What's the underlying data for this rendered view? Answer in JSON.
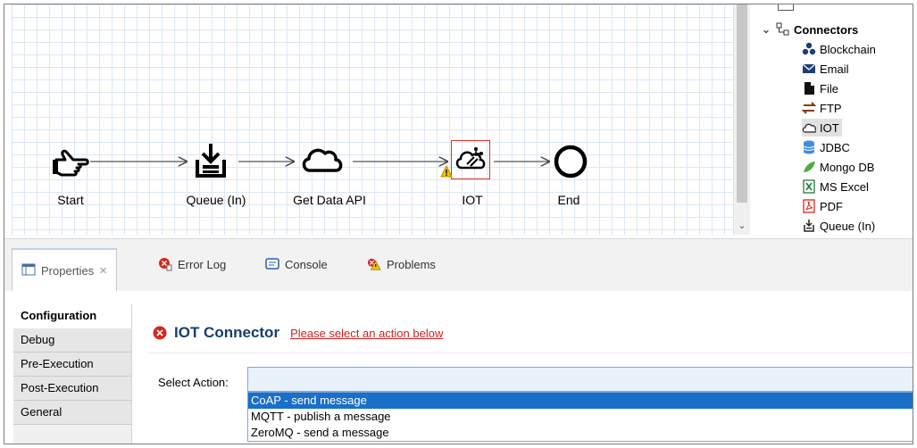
{
  "canvas": {
    "nodes": [
      {
        "label": "Start",
        "icon": "hand-point-icon"
      },
      {
        "label": "Queue (In)",
        "icon": "inbox-download-icon"
      },
      {
        "label": "Get Data API",
        "icon": "cloud-icon"
      },
      {
        "label": "IOT",
        "icon": "iot-cloud-icon"
      },
      {
        "label": "End",
        "icon": "end-circle-icon"
      }
    ]
  },
  "palette": {
    "group_label": "Connectors",
    "items": [
      {
        "label": "Blockchain",
        "icon": "blockchain-icon"
      },
      {
        "label": "Email",
        "icon": "email-icon"
      },
      {
        "label": "File",
        "icon": "file-icon"
      },
      {
        "label": "FTP",
        "icon": "ftp-arrows-icon"
      },
      {
        "label": "IOT",
        "icon": "iot-cloud-icon"
      },
      {
        "label": "JDBC",
        "icon": "database-icon"
      },
      {
        "label": "Mongo DB",
        "icon": "mongodb-leaf-icon"
      },
      {
        "label": "MS Excel",
        "icon": "excel-icon"
      },
      {
        "label": "PDF",
        "icon": "pdf-icon"
      },
      {
        "label": "Queue (In)",
        "icon": "inbox-download-icon"
      }
    ]
  },
  "tabs": [
    {
      "label": "Properties",
      "icon": "properties-icon"
    },
    {
      "label": "Error Log",
      "icon": "error-log-icon"
    },
    {
      "label": "Console",
      "icon": "console-icon"
    },
    {
      "label": "Problems",
      "icon": "problems-icon"
    }
  ],
  "side_tabs": [
    "Configuration",
    "Debug",
    "Pre-Execution",
    "Post-Execution",
    "General"
  ],
  "content": {
    "title": "IOT Connector",
    "warning": "Please select an action below",
    "select_label": "Select Action:",
    "select_value": "",
    "options": [
      "CoAP - send message",
      "MQTT - publish a message",
      "ZeroMQ - send a message"
    ],
    "highlighted_option": "CoAP - send message"
  },
  "colors": {
    "accent_blue": "#1a6fc9",
    "heading_blue": "#173e6b",
    "warning_red": "#d21f1f",
    "selection_outline": "#d9342b"
  }
}
